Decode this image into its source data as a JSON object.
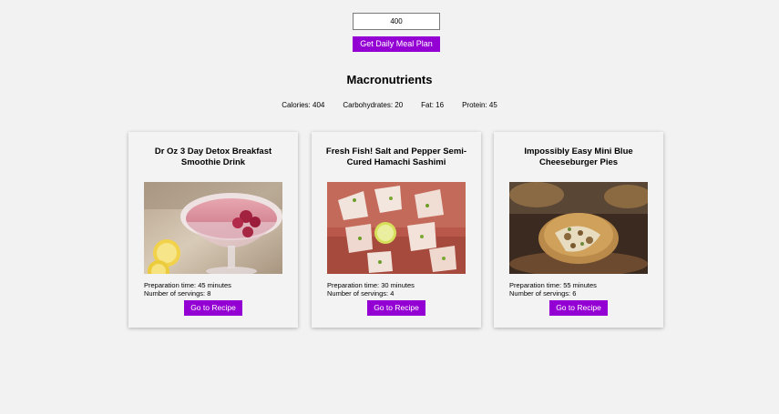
{
  "calorie_input": {
    "value": "400"
  },
  "plan_button": {
    "label": "Get Daily Meal Plan"
  },
  "macros": {
    "heading": "Macronutrients",
    "calories": "Calories: 404",
    "carbohydrates": "Carbohydrates: 20",
    "fat": "Fat: 16",
    "protein": "Protein: 45"
  },
  "meals": [
    {
      "title": "Dr Oz 3 Day Detox Breakfast Smoothie Drink",
      "prep": "Preparation time: 45 minutes",
      "servings": "Number of servings: 8",
      "button": "Go to Recipe",
      "image_alt": "smoothie-drink-photo"
    },
    {
      "title": "Fresh Fish! Salt and Pepper Semi-Cured Hamachi Sashimi",
      "prep": "Preparation time: 30 minutes",
      "servings": "Number of servings: 4",
      "button": "Go to Recipe",
      "image_alt": "hamachi-sashimi-photo"
    },
    {
      "title": "Impossibly Easy Mini Blue Cheeseburger Pies",
      "prep": "Preparation time: 55 minutes",
      "servings": "Number of servings: 6",
      "button": "Go to Recipe",
      "image_alt": "cheeseburger-pies-photo"
    }
  ],
  "colors": {
    "accent": "#9400d3",
    "background": "#f2f2f2",
    "card": "#f3f3f3"
  }
}
